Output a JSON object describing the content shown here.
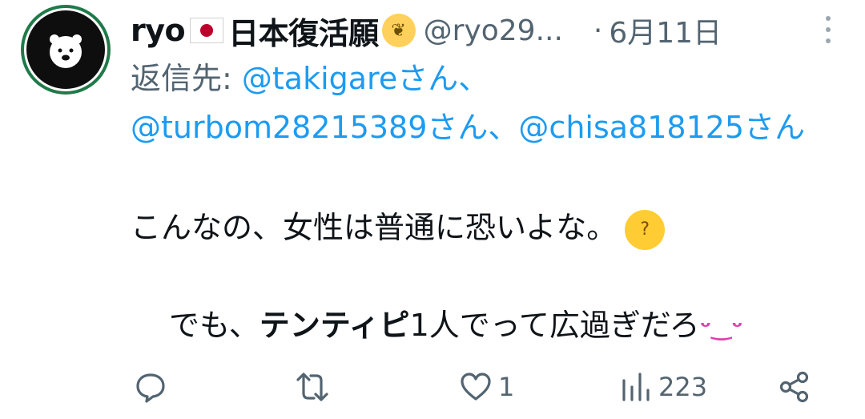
{
  "author": {
    "name": "ryo",
    "flag_icon": "japan-flag-icon",
    "name_suffix": "日本復活願",
    "emoji_icon": "face-hands-emoji-icon",
    "handle": "@ryo29...",
    "separator": "·",
    "date": "6月11日"
  },
  "reply": {
    "prefix": "返信先: ",
    "mention1": "@takigareさん、",
    "mention2": "@turbom28215389さん、",
    "mention3": "@chisa818125さん"
  },
  "tweet": {
    "line1": "こんなの、女性は普通に恐いよな。",
    "line1_emoji": "thinking-face-emoji-icon",
    "line2_pre": "でも、",
    "line2_bold": "テンティピ",
    "line2_post": "1人でって広過ぎだろ",
    "line2_emoji": "kissing-face-emoji-icon"
  },
  "actions": {
    "reply_count": "",
    "retweet_count": "",
    "like_count": "1",
    "views_count": "223"
  },
  "colors": {
    "link": "#1d9bf0",
    "muted": "#536471",
    "text": "#0f1419",
    "avatar_ring": "#1f7a4a"
  }
}
